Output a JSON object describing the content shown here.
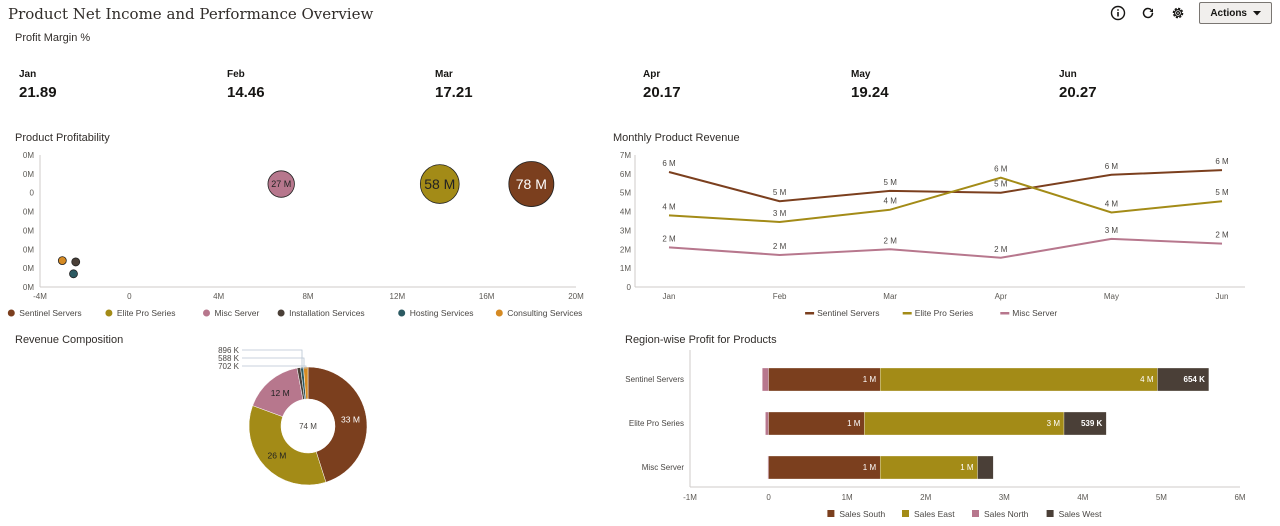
{
  "header": {
    "title": "Product Net Income and Performance Overview",
    "actions_label": "Actions",
    "icons": [
      "info-icon",
      "refresh-icon",
      "gear-icon",
      "caret-down-icon"
    ]
  },
  "kpi": {
    "title": "Profit Margin %",
    "items": [
      {
        "label": "Jan",
        "value": "21.89"
      },
      {
        "label": "Feb",
        "value": "14.46"
      },
      {
        "label": "Mar",
        "value": "17.21"
      },
      {
        "label": "Apr",
        "value": "20.17"
      },
      {
        "label": "May",
        "value": "19.24"
      },
      {
        "label": "Jun",
        "value": "20.27"
      }
    ]
  },
  "colors": {
    "sentinel": "#7b3f1e",
    "elite": "#a38b17",
    "misc": "#b7778d",
    "installation": "#4a3f37",
    "hosting": "#2c5a62",
    "consulting": "#d58a23",
    "axis": "#cfcbc8",
    "tick": "#5c5954"
  },
  "chart_data": [
    {
      "id": "product-profitability",
      "type": "scatter",
      "title": "Product Profitability",
      "xlabel": "",
      "ylabel": "",
      "x_ticks": [
        "-4M",
        "0",
        "4M",
        "8M",
        "12M",
        "16M",
        "20M"
      ],
      "xlim": [
        -4,
        20
      ],
      "y_ticks": [
        "0M",
        "0M",
        "0",
        "0M",
        "0M",
        "0M",
        "0M",
        "0M"
      ],
      "grid": false,
      "legend": "bottom",
      "series": [
        {
          "name": "Sentinel Servers",
          "x": 18,
          "y": 0.78,
          "size": 78,
          "label": "78 M",
          "color_key": "sentinel"
        },
        {
          "name": "Elite Pro Series",
          "x": 13.9,
          "y": 0.78,
          "size": 58,
          "label": "58 M",
          "color_key": "elite"
        },
        {
          "name": "Misc Server",
          "x": 6.8,
          "y": 0.78,
          "size": 27,
          "label": "27 M",
          "color_key": "misc"
        },
        {
          "name": "Installation Services",
          "x": -2.4,
          "y": 0.19,
          "size": 1,
          "label": "",
          "color_key": "installation"
        },
        {
          "name": "Hosting Services",
          "x": -2.5,
          "y": 0.1,
          "size": 0.6,
          "label": "",
          "color_key": "hosting"
        },
        {
          "name": "Consulting Services",
          "x": -3.0,
          "y": 0.2,
          "size": 1.3,
          "label": "",
          "color_key": "consulting"
        }
      ]
    },
    {
      "id": "monthly-product-revenue",
      "type": "line",
      "title": "Monthly Product Revenue",
      "categories": [
        "Jan",
        "Feb",
        "Mar",
        "Apr",
        "May",
        "Jun"
      ],
      "y_ticks": [
        "0",
        "1M",
        "2M",
        "3M",
        "4M",
        "5M",
        "6M",
        "7M"
      ],
      "ylim": [
        0,
        7
      ],
      "legend": "bottom",
      "series": [
        {
          "name": "Sentinel Servers",
          "color_key": "sentinel",
          "values": [
            6.1,
            4.55,
            5.1,
            5.0,
            5.95,
            6.2
          ],
          "labels": [
            "6 M",
            "5 M",
            "5 M",
            "5 M",
            "6 M",
            "6 M"
          ]
        },
        {
          "name": "Elite Pro Series",
          "color_key": "elite",
          "values": [
            3.8,
            3.45,
            4.1,
            5.8,
            3.95,
            4.55
          ],
          "labels": [
            "4 M",
            "3 M",
            "4 M",
            "6 M",
            "4 M",
            "5 M"
          ]
        },
        {
          "name": "Misc Server",
          "color_key": "misc",
          "values": [
            2.1,
            1.7,
            2.0,
            1.55,
            2.55,
            2.3
          ],
          "labels": [
            "2 M",
            "2 M",
            "2 M",
            "2 M",
            "3 M",
            "2 M"
          ]
        }
      ]
    },
    {
      "id": "revenue-composition",
      "type": "pie",
      "title": "Revenue Composition",
      "center_label": "74 M",
      "slices": [
        {
          "name": "Sentinel Servers",
          "value": 33,
          "label": "33 M",
          "color_key": "sentinel"
        },
        {
          "name": "Elite Pro Series",
          "value": 26,
          "label": "26 M",
          "color_key": "elite"
        },
        {
          "name": "Misc Server",
          "value": 12,
          "label": "12 M",
          "color_key": "misc"
        },
        {
          "name": "Installation Services",
          "value": 0.702,
          "label": "702 K",
          "color_key": "installation"
        },
        {
          "name": "Hosting Services",
          "value": 0.588,
          "label": "588 K",
          "color_key": "hosting"
        },
        {
          "name": "Consulting Services",
          "value": 0.896,
          "label": "896 K",
          "color_key": "consulting"
        }
      ]
    },
    {
      "id": "region-wise-profit",
      "type": "bar",
      "orientation": "horizontal",
      "stacked": true,
      "title": "Region-wise Profit for Products",
      "categories": [
        "Sentinel Servers",
        "Elite Pro Series",
        "Misc Server"
      ],
      "x_ticks": [
        "-1M",
        "0",
        "1M",
        "2M",
        "3M",
        "4M",
        "5M",
        "6M"
      ],
      "xlim": [
        -1,
        6
      ],
      "legend": "bottom",
      "series": [
        {
          "name": "Sales North",
          "color_key": "misc",
          "values": [
            -0.08,
            -0.04,
            -0.01
          ],
          "labels": [
            "",
            "",
            ""
          ]
        },
        {
          "name": "Sales South",
          "color_key": "sentinel",
          "values": [
            1.42,
            1.22,
            1.42
          ],
          "labels": [
            "1 M",
            "1 M",
            "1 M"
          ]
        },
        {
          "name": "Sales East",
          "color_key": "elite",
          "values": [
            3.53,
            2.54,
            1.24
          ],
          "labels": [
            "4 M",
            "3 M",
            "1 M"
          ]
        },
        {
          "name": "Sales West",
          "color_key": "installation",
          "values": [
            0.654,
            0.539,
            0.2
          ],
          "labels": [
            "654 K",
            "539 K",
            ""
          ]
        }
      ],
      "legend_order": [
        "Sales South",
        "Sales East",
        "Sales North",
        "Sales West"
      ]
    }
  ]
}
